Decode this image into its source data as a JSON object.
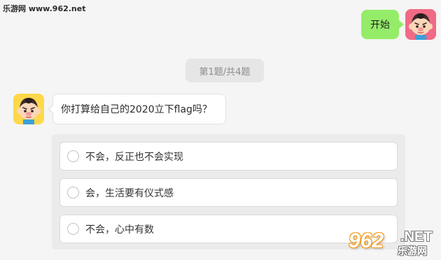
{
  "watermark_top": "乐游网 www.962.net",
  "chat": {
    "user_message": "开始",
    "progress": "第1题/共4题",
    "bot_question": "你打算给自己的2020立下flag吗？"
  },
  "options": [
    {
      "label": "不会，反正也不会实现",
      "selected": false
    },
    {
      "label": "会，生活要有仪式感",
      "selected": false
    },
    {
      "label": "不会，心中有数",
      "selected": false
    }
  ],
  "watermark_logo": {
    "number": "962",
    "domain": ".NET",
    "chinese": "乐游网"
  },
  "colors": {
    "page_bg": "#f5f5f5",
    "user_bubble": "#95ec69",
    "user_avatar_bg": "#f06a86",
    "bot_avatar_bg": "#ffd84a",
    "watermark_accent": "#f29a1a"
  },
  "icons": {
    "user_avatar": "cartoon-boy-avatar",
    "bot_avatar": "cartoon-boy-avatar",
    "option_radio": "radio-unchecked-icon"
  }
}
